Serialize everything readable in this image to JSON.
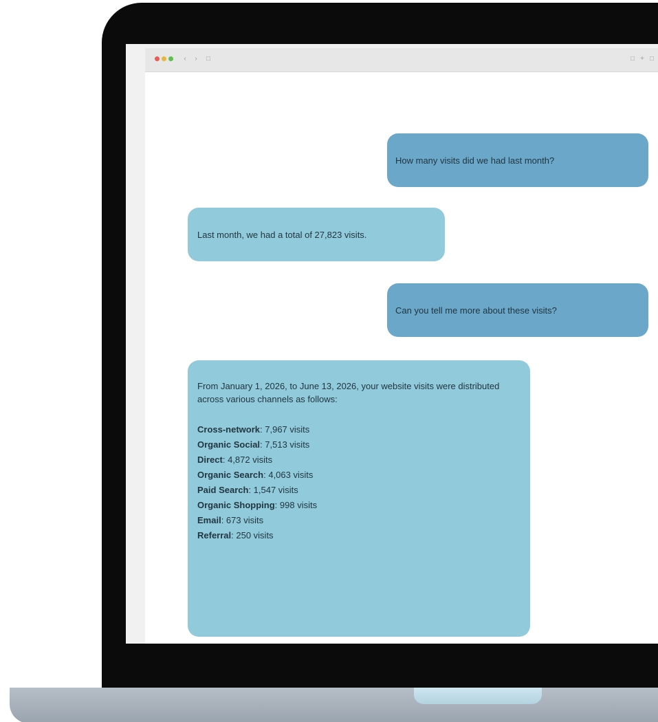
{
  "conversation": {
    "messages": [
      {
        "role": "user",
        "text": "How many visits did we had last month?"
      },
      {
        "role": "assistant",
        "text": "Last month, we had a total of 27,823 visits."
      },
      {
        "role": "user",
        "text": "Can you tell me more about these visits?"
      },
      {
        "role": "assistant",
        "intro": "From January 1, 2026, to June 13, 2026, your website visits were distributed across various channels as follows:",
        "channels": [
          {
            "name": "Cross-network",
            "value": ": 7,967 visits"
          },
          {
            "name": "Organic Social",
            "value": ": 7,513 visits"
          },
          {
            "name": "Direct",
            "value": ": 4,872 visits"
          },
          {
            "name": "Organic Search",
            "value": ": 4,063 visits"
          },
          {
            "name": "Paid Search",
            "value": ": 1,547 visits"
          },
          {
            "name": "Organic Shopping",
            "value": ": 998 visits"
          },
          {
            "name": "Email",
            "value": ": 673 visits"
          },
          {
            "name": "Referral",
            "value": ": 250 visits"
          }
        ]
      }
    ]
  },
  "colors": {
    "user_bubble": "#6aa7c9",
    "assistant_bubble": "#91cadb",
    "bezel": "#0b0b0b"
  },
  "icons": {
    "traffic_lights": [
      "close-dot-icon",
      "minimize-dot-icon",
      "zoom-dot-icon"
    ],
    "nav": [
      "back-icon",
      "forward-icon",
      "sidebar-icon"
    ]
  }
}
